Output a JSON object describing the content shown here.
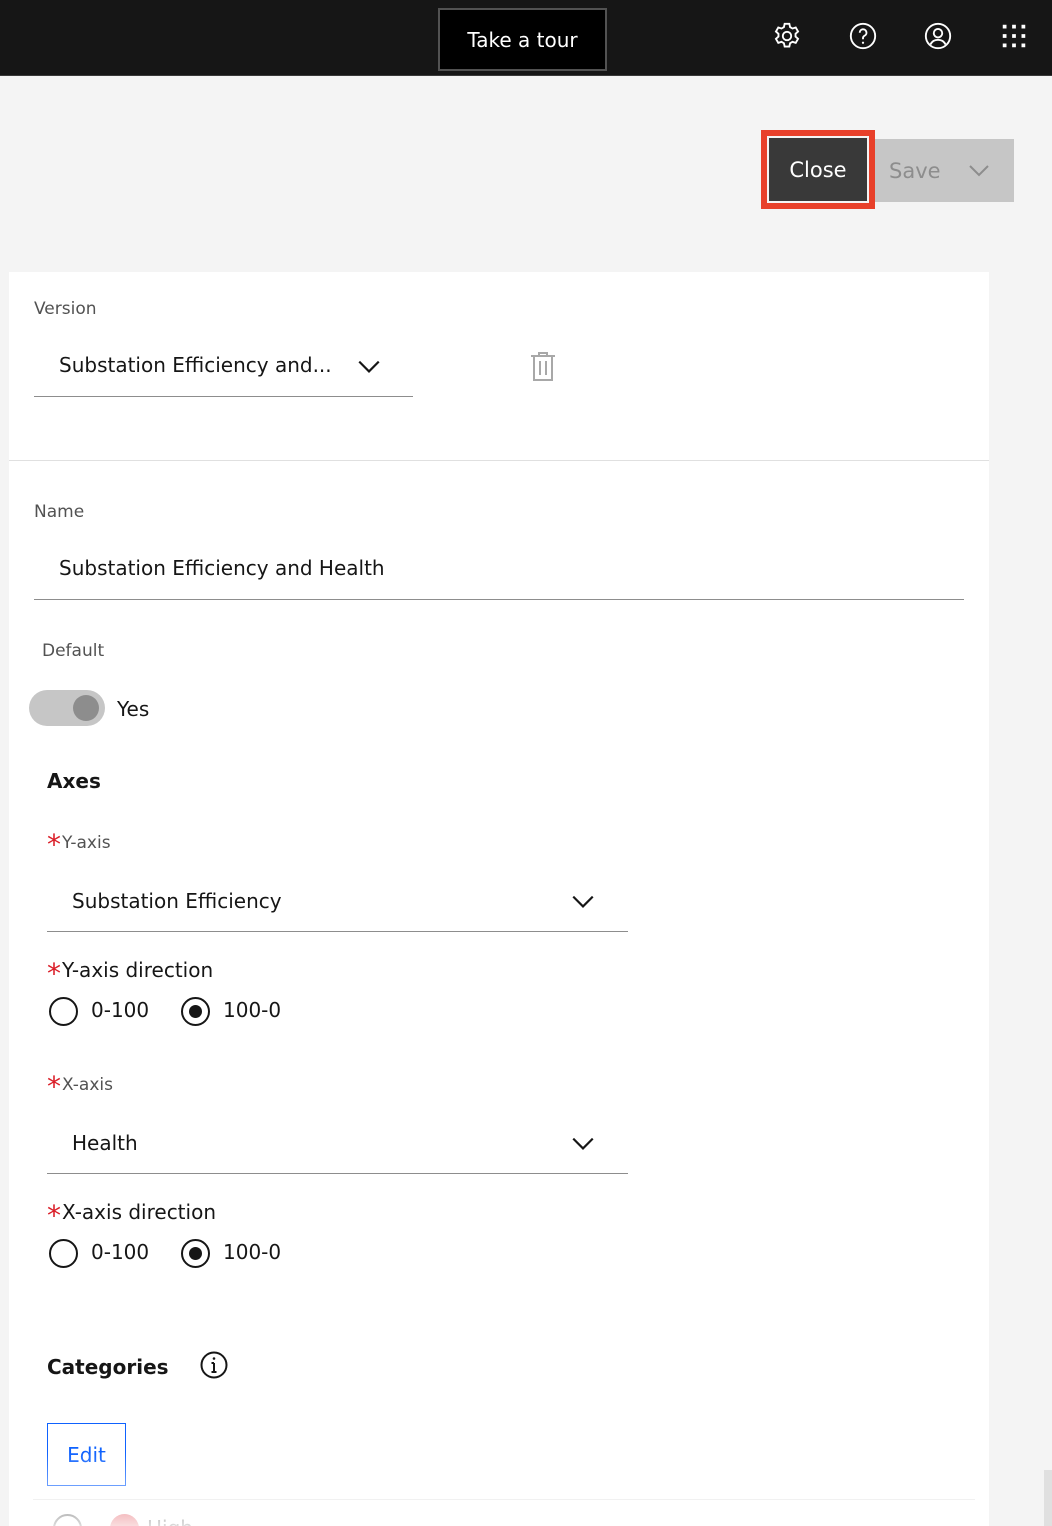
{
  "header": {
    "tour_label": "Take a tour",
    "icons": [
      "gear-icon",
      "help-icon",
      "user-icon",
      "app-switcher-icon"
    ]
  },
  "actions": {
    "close_label": "Close",
    "save_label": "Save"
  },
  "version": {
    "label": "Version",
    "value": "Substation Efficiency and..."
  },
  "name": {
    "label": "Name",
    "value": "Substation Efficiency and Health"
  },
  "default": {
    "label": "Default",
    "toggle_label": "Yes",
    "on": true
  },
  "axes": {
    "title": "Axes",
    "required_mark": "*",
    "y_axis": {
      "label": "Y-axis",
      "value": "Substation Efficiency"
    },
    "y_direction": {
      "label": "Y-axis direction",
      "options": [
        "0-100",
        "100-0"
      ],
      "selected": "100-0"
    },
    "x_axis": {
      "label": "X-axis",
      "value": "Health"
    },
    "x_direction": {
      "label": "X-axis direction",
      "options": [
        "0-100",
        "100-0"
      ],
      "selected": "100-0"
    }
  },
  "categories": {
    "title": "Categories",
    "edit_label": "Edit",
    "first_item": "High"
  },
  "colors": {
    "topbar": "#161616",
    "highlight": "#e8402a",
    "required": "#da1e28",
    "link": "#0f62fe"
  }
}
